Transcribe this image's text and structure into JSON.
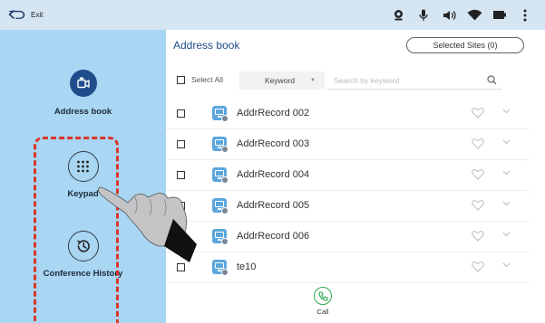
{
  "topbar": {
    "back_label": "Exit",
    "status_icons": [
      "camera-icon",
      "microphone-icon",
      "speaker-icon",
      "wifi-icon",
      "battery-icon",
      "more-vertical-icon"
    ]
  },
  "sidebar": {
    "items": [
      {
        "label": "Address book",
        "icon": "address-book-icon",
        "active": true
      },
      {
        "label": "Keypad",
        "icon": "keypad-icon",
        "active": false
      },
      {
        "label": "Conference History",
        "icon": "history-icon",
        "active": false
      }
    ],
    "highlight_color": "#d9362a"
  },
  "main": {
    "title": "Address book",
    "selected_sites": "Selected Sites (0)",
    "select_all": "Select All",
    "keyword": "Keyword",
    "search_placeholder": "Search by keyword",
    "records": [
      {
        "name": "AddrRecord 002"
      },
      {
        "name": "AddrRecord 003"
      },
      {
        "name": "AddrRecord 004"
      },
      {
        "name": "AddrRecord 005"
      },
      {
        "name": "AddrRecord 006"
      },
      {
        "name": "te10"
      }
    ],
    "call_label": "Call"
  },
  "colors": {
    "accent": "#1f4b86",
    "sidebar_bg": "#a9d6f2",
    "call_green": "#2fa84f"
  }
}
